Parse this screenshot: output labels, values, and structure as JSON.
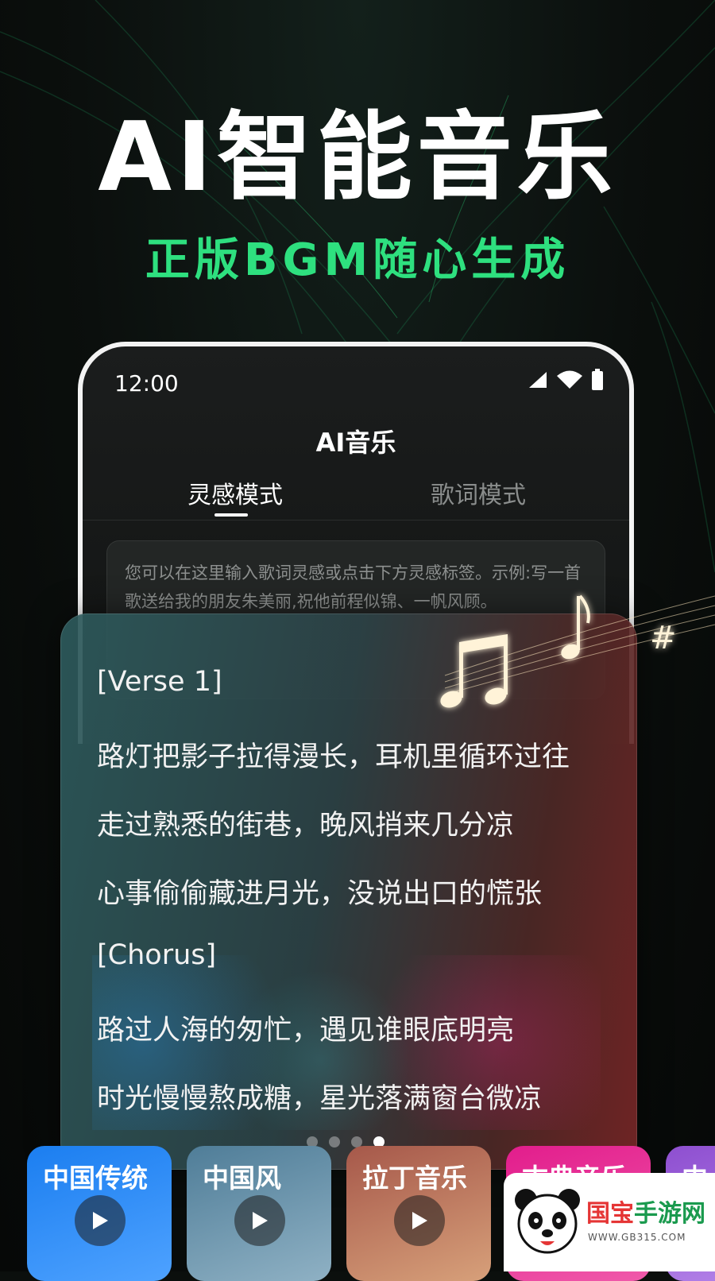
{
  "hero": {
    "title": "AI智能音乐",
    "subtitle": "正版BGM随心生成"
  },
  "phone": {
    "status_time": "12:00",
    "status_icons": [
      "signal-icon",
      "wifi-icon",
      "battery-icon"
    ],
    "app_title": "AI音乐",
    "tabs": [
      {
        "label": "灵感模式",
        "active": true
      },
      {
        "label": "歌词模式",
        "active": false
      }
    ],
    "prompt_placeholder": "您可以在这里输入歌词灵感或点击下方灵感标签。示例:写一首歌送给我的朋友朱美丽,祝他前程似锦、一帆风顾。"
  },
  "lyrics": {
    "lines": [
      "[Verse 1]",
      "路灯把影子拉得漫长，耳机里循环过往",
      "走过熟悉的街巷，晚风捎来几分凉",
      "心事偷偷藏进月光，没说出口的慌张",
      "[Chorus]",
      "路过人海的匆忙，遇见谁眼底明亮",
      "时光慢慢熬成糖，星光落满窗台微凉"
    ]
  },
  "carousel": {
    "dot_count": 4,
    "active_index": 3
  },
  "genres": [
    {
      "label": "中国传统",
      "color": "#1b7ef0"
    },
    {
      "label": "中国风",
      "color": "#5f8ea8"
    },
    {
      "label": "拉丁音乐",
      "color": "#b86b55"
    },
    {
      "label": "古典音乐",
      "color": "#e21d8c"
    },
    {
      "label": "中",
      "color": "#9b5bd6"
    }
  ],
  "watermark": {
    "name_red": "国宝",
    "name_green": "手游网",
    "url": "WWW.GB315.COM"
  }
}
